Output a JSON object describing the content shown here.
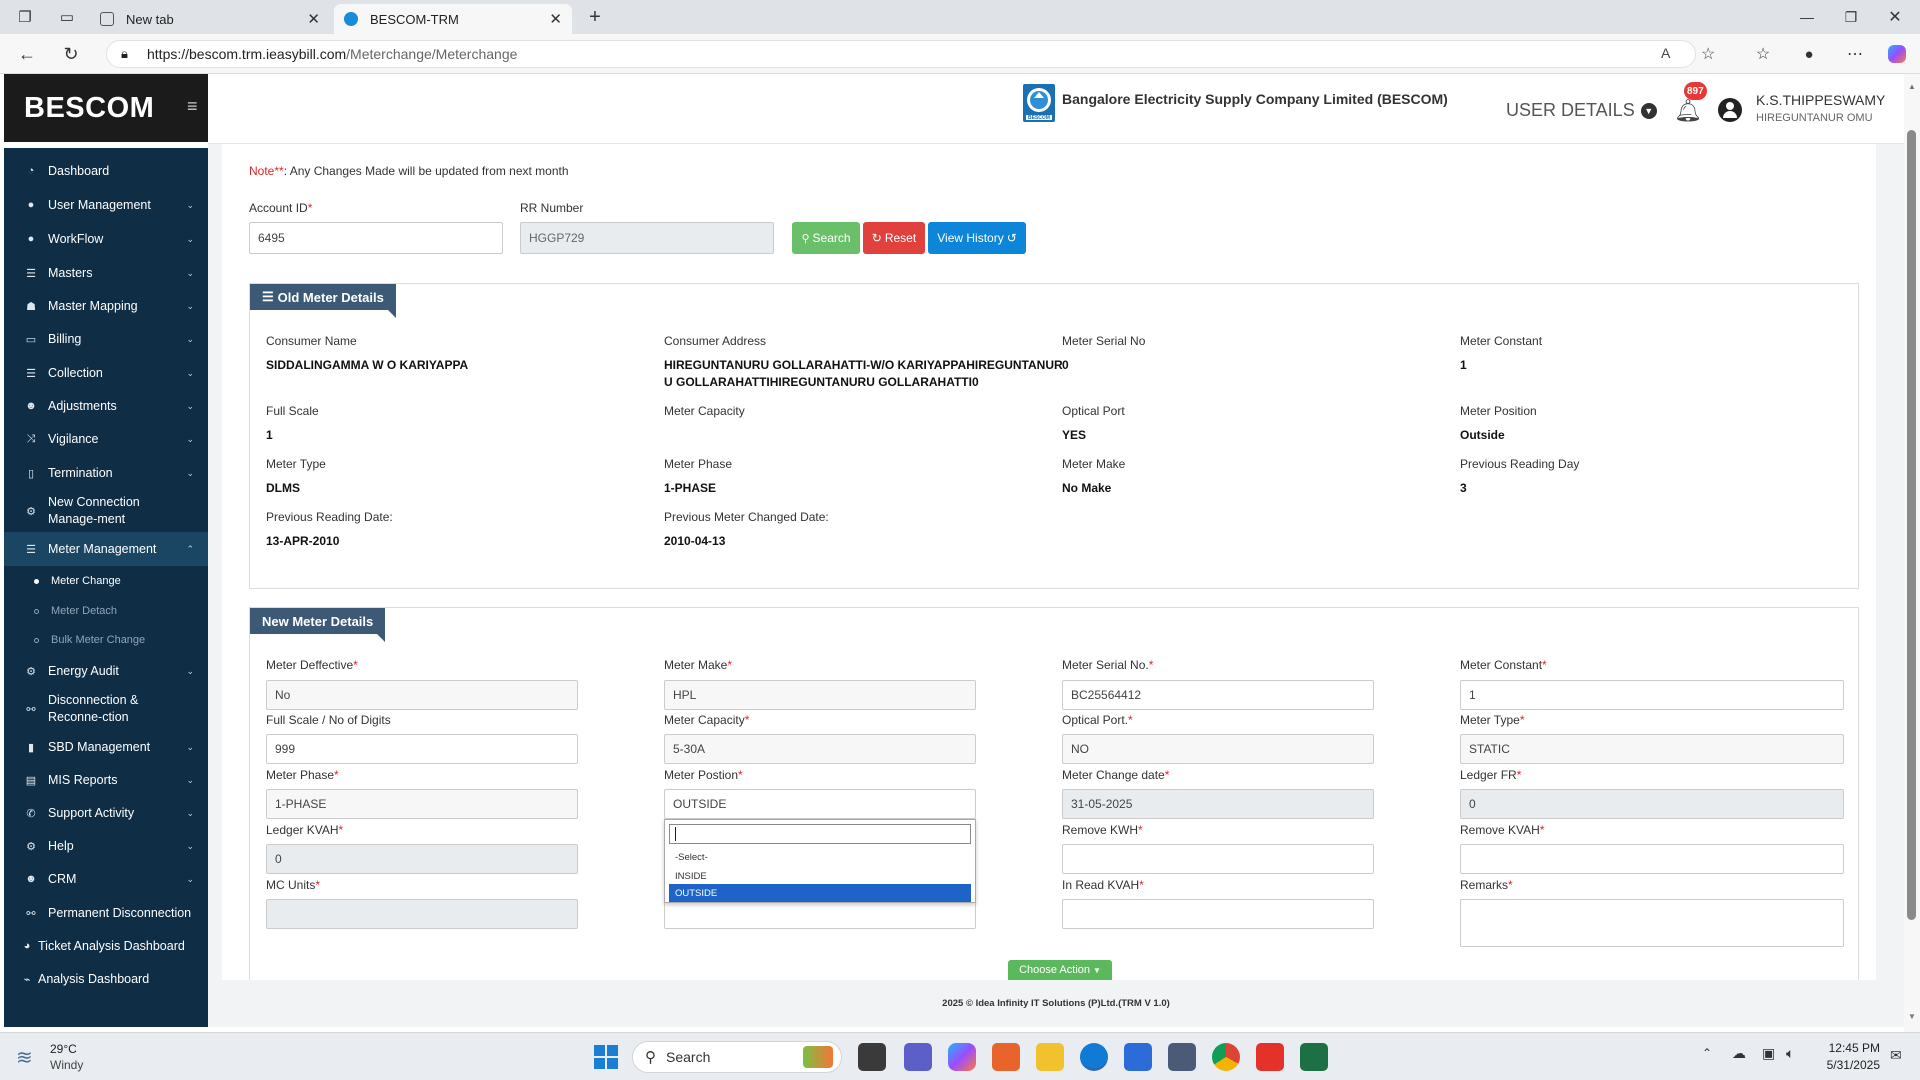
{
  "browser": {
    "tabs": [
      {
        "label": "New tab",
        "active": false
      },
      {
        "label": "BESCOM-TRM",
        "active": true
      }
    ],
    "url_domain": "https://bescom.trm.ieasybill.com",
    "url_path": "/Meterchange/Meterchange"
  },
  "sidebar": {
    "brand": "BESCOM",
    "items": [
      {
        "label": "Dashboard",
        "icon": "dashboard-icon",
        "chevron": false
      },
      {
        "label": "User Management",
        "icon": "user-icon",
        "chevron": true
      },
      {
        "label": "WorkFlow",
        "icon": "user-icon",
        "chevron": true
      },
      {
        "label": "Masters",
        "icon": "list-icon",
        "chevron": true
      },
      {
        "label": "Master Mapping",
        "icon": "sitemap-icon",
        "chevron": true
      },
      {
        "label": "Billing",
        "icon": "monitor-icon",
        "chevron": true
      },
      {
        "label": "Collection",
        "icon": "list-icon",
        "chevron": true
      },
      {
        "label": "Adjustments",
        "icon": "users-icon",
        "chevron": true
      },
      {
        "label": "Vigilance",
        "icon": "shuffle-icon",
        "chevron": true
      },
      {
        "label": "Termination",
        "icon": "trash-icon",
        "chevron": true
      },
      {
        "label": "New Connection Manage-ment",
        "icon": "gear-icon",
        "chevron": true
      },
      {
        "label": "Meter Management",
        "icon": "list-icon",
        "chevron": true
      }
    ],
    "submenu": [
      {
        "label": "Meter Change",
        "current": true
      },
      {
        "label": "Meter Detach",
        "current": false
      },
      {
        "label": "Bulk Meter Change",
        "current": false
      }
    ],
    "items_after": [
      {
        "label": "Energy Audit",
        "icon": "gear-icon",
        "chevron": true
      },
      {
        "label": "Disconnection & Reconne-ction",
        "icon": "link-icon",
        "chevron": true
      },
      {
        "label": "SBD Management",
        "icon": "bar-icon",
        "chevron": true
      },
      {
        "label": "MIS Reports",
        "icon": "file-icon",
        "chevron": true
      },
      {
        "label": "Support Activity",
        "icon": "phone-icon",
        "chevron": true
      },
      {
        "label": "Help",
        "icon": "gear-icon",
        "chevron": true
      },
      {
        "label": "CRM",
        "icon": "group-icon",
        "chevron": true
      },
      {
        "label": "Permanent Disconnection",
        "icon": "link-icon",
        "chevron": false
      },
      {
        "label": "Ticket Analysis Dashboard",
        "icon": "pie-icon",
        "chevron": false
      },
      {
        "label": "Analysis Dashboard",
        "icon": "chart-icon",
        "chevron": false
      }
    ]
  },
  "header": {
    "logo_text": "BESCOM",
    "company": "Bangalore Electricity Supply Company Limited (BESCOM)",
    "user_details": "USER DETAILS",
    "notif_count": "897",
    "user_name": "K.S.THIPPESWAMY",
    "user_sub": "HIREGUNTANUR OMU"
  },
  "note": {
    "prefix": "Note",
    "stars": "**",
    "text": ": Any Changes Made will be updated from next month"
  },
  "search_form": {
    "account_label": "Account ID",
    "account_value": "6495",
    "rr_label": "RR Number",
    "rr_value": "HGGP729",
    "search_btn": "Search",
    "reset_btn": "Reset",
    "history_btn": "View History"
  },
  "old_meter": {
    "title": "Old Meter Details",
    "fields": [
      {
        "label": "Consumer Name",
        "value": "SIDDALINGAMMA W O KARIYAPPA"
      },
      {
        "label": "Consumer Address",
        "value": "HIREGUNTANURU GOLLARAHATTI-W/O KARIYAPPAHIREGUNTANUR"
      },
      {
        "label": "Meter Serial No",
        "value": "0"
      },
      {
        "label": "Meter Constant",
        "value": "1"
      },
      {
        "label": "Full Scale",
        "value": "1"
      },
      {
        "label": "Meter Capacity",
        "value": ""
      },
      {
        "label": "Optical Port",
        "value": "YES"
      },
      {
        "label": "Meter Position",
        "value": "Outside"
      },
      {
        "label": "Meter Type",
        "value": "DLMS"
      },
      {
        "label": "Meter Phase",
        "value": "1-PHASE"
      },
      {
        "label": "Meter Make",
        "value": "No Make"
      },
      {
        "label": "Previous Reading Day",
        "value": "3"
      },
      {
        "label": "Previous Reading Date:",
        "value": "13-APR-2010"
      },
      {
        "label": "Previous Meter Changed Date:",
        "value": "2010-04-13"
      }
    ],
    "address_line2": "U GOLLARAHATTIHIREGUNTANURU GOLLARAHATTI0"
  },
  "new_meter": {
    "title": "New Meter Details",
    "fields": [
      {
        "label": "Meter Deffective",
        "value": "No",
        "kind": "select"
      },
      {
        "label": "Meter Make",
        "value": "HPL",
        "kind": "select"
      },
      {
        "label": "Meter Serial No.",
        "value": "BC25564412",
        "kind": "input"
      },
      {
        "label": "Meter Constant",
        "value": "1",
        "kind": "input"
      },
      {
        "label": "Full Scale / No of Digits",
        "value": "999",
        "kind": "input"
      },
      {
        "label": "Meter Capacity",
        "value": "5-30A",
        "kind": "select"
      },
      {
        "label": "Optical Port.",
        "value": "NO",
        "kind": "select"
      },
      {
        "label": "Meter Type",
        "value": "STATIC",
        "kind": "select"
      },
      {
        "label": "Meter Phase",
        "value": "1-PHASE",
        "kind": "select"
      },
      {
        "label": "Meter Postion",
        "value": "OUTSIDE",
        "kind": "select-open"
      },
      {
        "label": "Meter Change date",
        "value": "31-05-2025",
        "kind": "readonly"
      },
      {
        "label": "Ledger FR",
        "value": "0",
        "kind": "readonly"
      },
      {
        "label": "Ledger KVAH",
        "value": "0",
        "kind": "readonly"
      },
      {
        "label": "",
        "value": "",
        "kind": "hidden"
      },
      {
        "label": "Remove KWH",
        "value": "",
        "kind": "input"
      },
      {
        "label": "Remove KVAH",
        "value": "",
        "kind": "input"
      },
      {
        "label": "MC Units",
        "value": "",
        "kind": "readonly"
      },
      {
        "label": "",
        "value": "",
        "kind": "hidden"
      },
      {
        "label": "In Read KVAH",
        "value": "",
        "kind": "input"
      },
      {
        "label": "Remarks",
        "value": "",
        "kind": "textarea"
      }
    ],
    "dropdown_options": [
      "-Select-",
      "INSIDE",
      "OUTSIDE"
    ],
    "dropdown_selected": "OUTSIDE",
    "choose_action": "Choose Action"
  },
  "footer": "2025 © Idea Infinity IT Solutions (P)Ltd.(TRM V 1.0)",
  "taskbar": {
    "weather_temp": "29°C",
    "weather_desc": "Windy",
    "search": "Search",
    "time": "12:45 PM",
    "date": "5/31/2025"
  },
  "colors": {
    "sidebar": "#0f2d45",
    "search_btn": "#5cb85c",
    "reset_btn": "#d9534f",
    "history_btn": "#0d85d8",
    "legend": "#3c5a76",
    "selected_option": "#1e63c7"
  }
}
